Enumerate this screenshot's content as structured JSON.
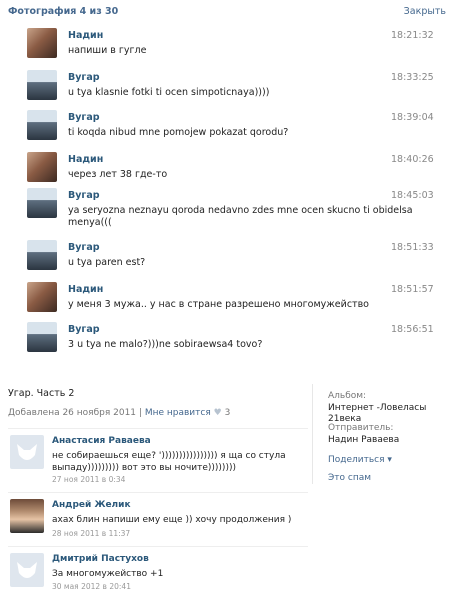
{
  "header": {
    "title": "Фотография 4 из 30",
    "close": "Закрыть"
  },
  "messages": [
    {
      "author": "Надин",
      "time": "18:21:32",
      "text": "напиши в гугле",
      "avatar": "nadin"
    },
    {
      "author": "Вугар",
      "time": "18:33:25",
      "text": "u tya klasnie fotki ti ocen simpoticnaya))))",
      "avatar": "vugar"
    },
    {
      "author": "Вугар",
      "time": "18:39:04",
      "text": "ti koqda nibud mne pomojew pokazat qorodu?",
      "avatar": "vugar"
    },
    {
      "author": "Надин",
      "time": "18:40:26",
      "text": "через лет 38 где-то",
      "avatar": "nadin"
    },
    {
      "author": "Вугар",
      "time": "18:45:03",
      "text": "ya seryozna neznayu qoroda nedavno zdes mne ocen skucno ti obidelsa menya(((",
      "avatar": "vugar"
    },
    {
      "author": "Вугар",
      "time": "18:51:33",
      "text": "u tya paren est?",
      "avatar": "vugar"
    },
    {
      "author": "Надин",
      "time": "18:51:57",
      "text": "у меня 3 мужа.. у нас в стране разрешено многомужейство",
      "avatar": "nadin"
    },
    {
      "author": "Вугар",
      "time": "18:56:51",
      "text": "3 u tya ne malo?)))ne sobiraewsa4 tovo?",
      "avatar": "vugar"
    }
  ],
  "post": {
    "title": "Угар. Часть 2",
    "added": "Добавлена 26 ноября 2011",
    "separator": "|",
    "like_label": "Мне нравится",
    "heart": "♥",
    "likes": "3"
  },
  "side": {
    "album_label": "Альбом:",
    "album_value": "Интернет -Ловеласы 21века",
    "sender_label": "Отправитель:",
    "sender_value": "Надин Раваева",
    "share": "Поделиться ▾",
    "spam": "Это спам"
  },
  "comments": [
    {
      "author": "Анастасия Раваева",
      "text": "не собираешься еще? ')))))))))))))))) я ща со стула выпаду))))))))) вот это вы ночите))))))))",
      "date": "27 ноя 2011 в 0:34",
      "avatar": "default"
    },
    {
      "author": "Андрей Желик",
      "text": "ахах блин напиши ему еще )) хочу продолжения )",
      "date": "28 ноя 2011 в 11:37",
      "avatar": "photo"
    },
    {
      "author": "Дмитрий Пастухов",
      "text": "За многомужейство +1",
      "date": "30 мая 2012 в 20:41",
      "avatar": "default"
    }
  ]
}
